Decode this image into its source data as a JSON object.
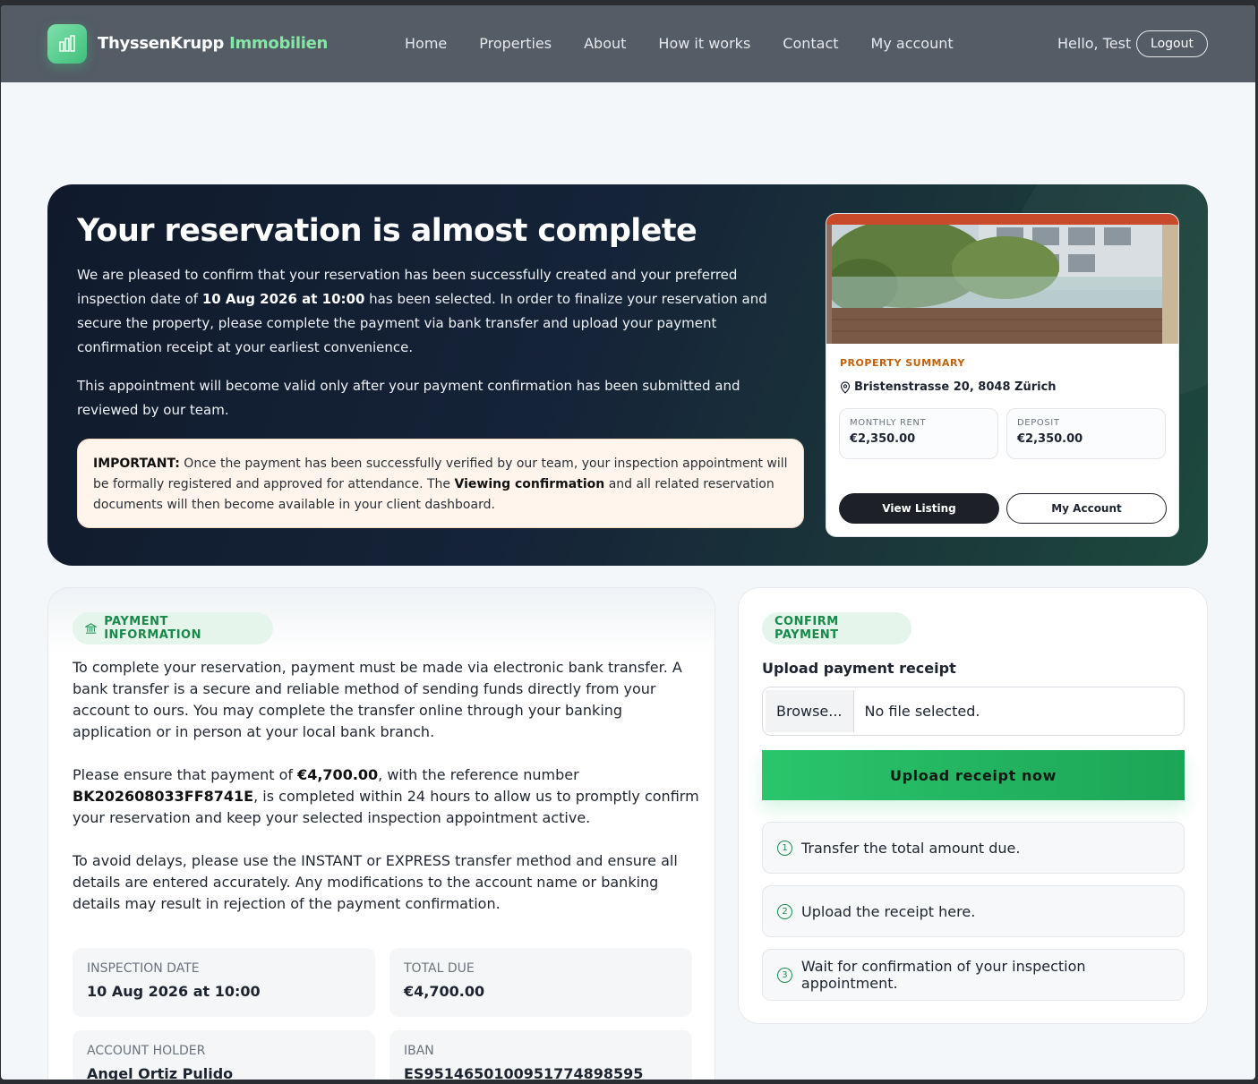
{
  "nav": {
    "brand_main": "ThyssenKrupp",
    "brand_accent": "Immobilien",
    "links": [
      "Home",
      "Properties",
      "About",
      "How it works",
      "Contact",
      "My account"
    ],
    "greeting": "Hello, Test",
    "logout": "Logout"
  },
  "hero": {
    "title": "Your reservation is almost complete",
    "p1_a": "We are pleased to confirm that your reservation has been successfully created and your preferred inspection date of ",
    "p1_date": "10 Aug 2026 at 10:00",
    "p1_b": " has been selected. In order to finalize your reservation and secure the property, please complete the payment via bank transfer and upload your payment confirmation receipt at your earliest convenience.",
    "p2": "This appointment will become valid only after your payment confirmation has been submitted and reviewed by our team.",
    "important_label": "IMPORTANT:",
    "important_a": " Once the payment has been successfully verified by our team, your inspection appointment will be formally registered and approved for attendance. The ",
    "important_bold": "Viewing confirmation",
    "important_b": " and all related reservation documents will then become available in your client dashboard."
  },
  "property": {
    "summary_label": "PROPERTY SUMMARY",
    "address": "Bristenstrasse 20, 8048 Zürich",
    "rent_label": "MONTHLY RENT",
    "rent_value": "€2,350.00",
    "deposit_label": "DEPOSIT",
    "deposit_value": "€2,350.00",
    "view_listing": "View Listing",
    "my_account": "My Account"
  },
  "payment": {
    "pill": "PAYMENT INFORMATION",
    "para1": "To complete your reservation, payment must be made via electronic bank transfer. A bank transfer is a secure and reliable method of sending funds directly from your account to ours. You may complete the transfer online through your banking application or in person at your local bank branch.",
    "para2_a": "Please ensure that payment of ",
    "para2_amount": "€4,700.00",
    "para2_b": ", with the reference number ",
    "para2_ref": "BK202608033FF8741E",
    "para2_c": ", is completed within 24 hours to allow us to promptly confirm your reservation and keep your selected inspection appointment active.",
    "para3": "To avoid delays, please use the INSTANT or EXPRESS transfer method and ensure all details are entered accurately. Any modifications to the account name or banking details may result in rejection of the payment confirmation.",
    "inspection_label": "INSPECTION DATE",
    "inspection_value": "10 Aug 2026 at 10:00",
    "total_label": "TOTAL DUE",
    "total_value": "€4,700.00",
    "holder_label": "ACCOUNT HOLDER",
    "holder_value": "Angel Ortiz Pulido",
    "iban_label": "IBAN",
    "iban_value": "ES9514650100951774898595"
  },
  "confirm": {
    "pill": "CONFIRM PAYMENT",
    "upload_label": "Upload payment receipt",
    "browse": "Browse...",
    "no_file": "No file selected.",
    "upload_button": "Upload receipt now",
    "steps": [
      {
        "num": "1",
        "text": "Transfer the total amount due."
      },
      {
        "num": "2",
        "text": "Upload the receipt here."
      },
      {
        "num": "3",
        "text": "Wait for confirmation of your inspection appointment."
      }
    ]
  }
}
